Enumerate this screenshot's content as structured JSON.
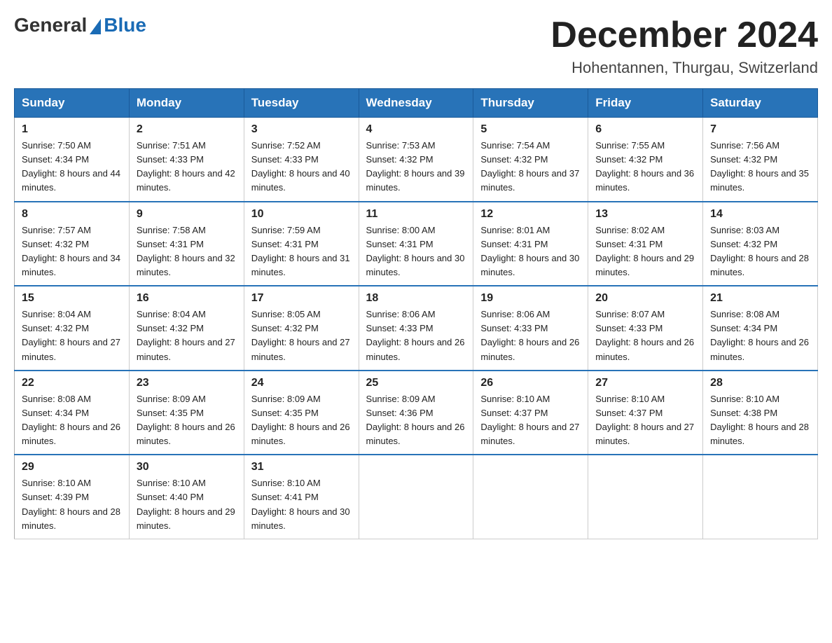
{
  "logo": {
    "general": "General",
    "blue": "Blue"
  },
  "header": {
    "month": "December 2024",
    "location": "Hohentannen, Thurgau, Switzerland"
  },
  "days_of_week": [
    "Sunday",
    "Monday",
    "Tuesday",
    "Wednesday",
    "Thursday",
    "Friday",
    "Saturday"
  ],
  "weeks": [
    [
      {
        "day": "1",
        "sunrise": "7:50 AM",
        "sunset": "4:34 PM",
        "daylight": "8 hours and 44 minutes."
      },
      {
        "day": "2",
        "sunrise": "7:51 AM",
        "sunset": "4:33 PM",
        "daylight": "8 hours and 42 minutes."
      },
      {
        "day": "3",
        "sunrise": "7:52 AM",
        "sunset": "4:33 PM",
        "daylight": "8 hours and 40 minutes."
      },
      {
        "day": "4",
        "sunrise": "7:53 AM",
        "sunset": "4:32 PM",
        "daylight": "8 hours and 39 minutes."
      },
      {
        "day": "5",
        "sunrise": "7:54 AM",
        "sunset": "4:32 PM",
        "daylight": "8 hours and 37 minutes."
      },
      {
        "day": "6",
        "sunrise": "7:55 AM",
        "sunset": "4:32 PM",
        "daylight": "8 hours and 36 minutes."
      },
      {
        "day": "7",
        "sunrise": "7:56 AM",
        "sunset": "4:32 PM",
        "daylight": "8 hours and 35 minutes."
      }
    ],
    [
      {
        "day": "8",
        "sunrise": "7:57 AM",
        "sunset": "4:32 PM",
        "daylight": "8 hours and 34 minutes."
      },
      {
        "day": "9",
        "sunrise": "7:58 AM",
        "sunset": "4:31 PM",
        "daylight": "8 hours and 32 minutes."
      },
      {
        "day": "10",
        "sunrise": "7:59 AM",
        "sunset": "4:31 PM",
        "daylight": "8 hours and 31 minutes."
      },
      {
        "day": "11",
        "sunrise": "8:00 AM",
        "sunset": "4:31 PM",
        "daylight": "8 hours and 30 minutes."
      },
      {
        "day": "12",
        "sunrise": "8:01 AM",
        "sunset": "4:31 PM",
        "daylight": "8 hours and 30 minutes."
      },
      {
        "day": "13",
        "sunrise": "8:02 AM",
        "sunset": "4:31 PM",
        "daylight": "8 hours and 29 minutes."
      },
      {
        "day": "14",
        "sunrise": "8:03 AM",
        "sunset": "4:32 PM",
        "daylight": "8 hours and 28 minutes."
      }
    ],
    [
      {
        "day": "15",
        "sunrise": "8:04 AM",
        "sunset": "4:32 PM",
        "daylight": "8 hours and 27 minutes."
      },
      {
        "day": "16",
        "sunrise": "8:04 AM",
        "sunset": "4:32 PM",
        "daylight": "8 hours and 27 minutes."
      },
      {
        "day": "17",
        "sunrise": "8:05 AM",
        "sunset": "4:32 PM",
        "daylight": "8 hours and 27 minutes."
      },
      {
        "day": "18",
        "sunrise": "8:06 AM",
        "sunset": "4:33 PM",
        "daylight": "8 hours and 26 minutes."
      },
      {
        "day": "19",
        "sunrise": "8:06 AM",
        "sunset": "4:33 PM",
        "daylight": "8 hours and 26 minutes."
      },
      {
        "day": "20",
        "sunrise": "8:07 AM",
        "sunset": "4:33 PM",
        "daylight": "8 hours and 26 minutes."
      },
      {
        "day": "21",
        "sunrise": "8:08 AM",
        "sunset": "4:34 PM",
        "daylight": "8 hours and 26 minutes."
      }
    ],
    [
      {
        "day": "22",
        "sunrise": "8:08 AM",
        "sunset": "4:34 PM",
        "daylight": "8 hours and 26 minutes."
      },
      {
        "day": "23",
        "sunrise": "8:09 AM",
        "sunset": "4:35 PM",
        "daylight": "8 hours and 26 minutes."
      },
      {
        "day": "24",
        "sunrise": "8:09 AM",
        "sunset": "4:35 PM",
        "daylight": "8 hours and 26 minutes."
      },
      {
        "day": "25",
        "sunrise": "8:09 AM",
        "sunset": "4:36 PM",
        "daylight": "8 hours and 26 minutes."
      },
      {
        "day": "26",
        "sunrise": "8:10 AM",
        "sunset": "4:37 PM",
        "daylight": "8 hours and 27 minutes."
      },
      {
        "day": "27",
        "sunrise": "8:10 AM",
        "sunset": "4:37 PM",
        "daylight": "8 hours and 27 minutes."
      },
      {
        "day": "28",
        "sunrise": "8:10 AM",
        "sunset": "4:38 PM",
        "daylight": "8 hours and 28 minutes."
      }
    ],
    [
      {
        "day": "29",
        "sunrise": "8:10 AM",
        "sunset": "4:39 PM",
        "daylight": "8 hours and 28 minutes."
      },
      {
        "day": "30",
        "sunrise": "8:10 AM",
        "sunset": "4:40 PM",
        "daylight": "8 hours and 29 minutes."
      },
      {
        "day": "31",
        "sunrise": "8:10 AM",
        "sunset": "4:41 PM",
        "daylight": "8 hours and 30 minutes."
      },
      null,
      null,
      null,
      null
    ]
  ],
  "labels": {
    "sunrise": "Sunrise:",
    "sunset": "Sunset:",
    "daylight": "Daylight:"
  }
}
